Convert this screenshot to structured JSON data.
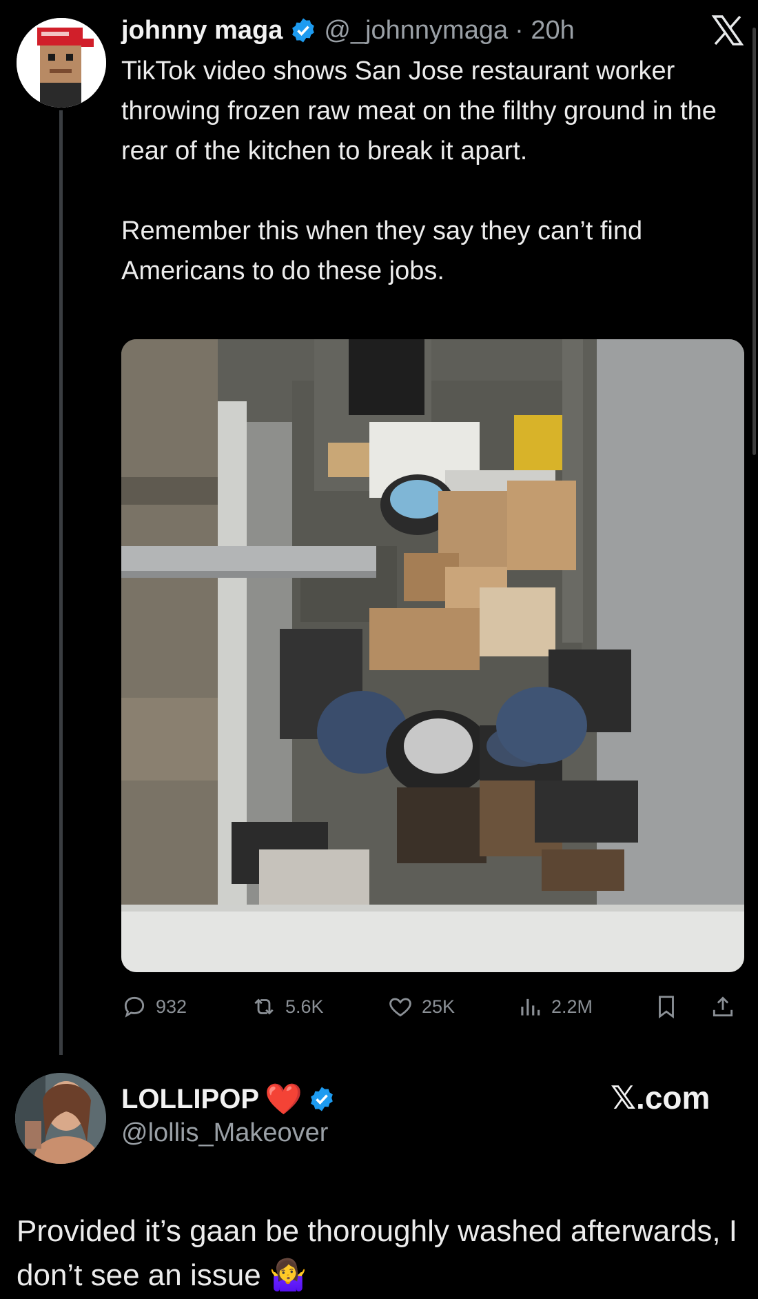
{
  "tweet": {
    "author_name": "johnny maga",
    "author_handle": "@_johnnymaga",
    "time": "· 20h",
    "paragraph_1": "TikTok video shows San Jose restaurant worker throwing frozen raw meat on the filthy ground in the rear of the kitchen to break it apart.",
    "paragraph_2": "Remember this when they say they can’t find Americans to do these jobs.",
    "stats": {
      "replies": "932",
      "reposts": "5.6K",
      "likes": "25K",
      "views": "2.2M"
    }
  },
  "reply": {
    "author_name": "LOLLIPOP",
    "heart_emoji": "❤️",
    "author_handle": "@lollis_Makeover",
    "watermark": "𝕏.com",
    "text": "Provided it’s gaan be thoroughly washed afterwards, I don’t see an issue",
    "emoji": "🤷‍♀️"
  },
  "colors": {
    "background": "#000000",
    "text": "#e7e9ea",
    "secondary": "#9aa0a6",
    "verified": "#1d9bf0",
    "heart": "#e0282e"
  }
}
